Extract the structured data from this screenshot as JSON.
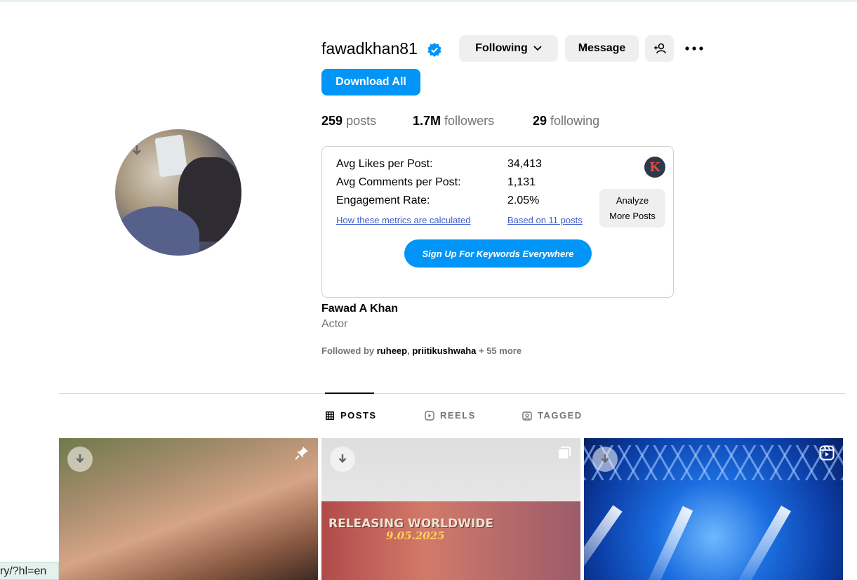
{
  "profile": {
    "username": "fawadkhan81",
    "verified": true,
    "full_name": "Fawad A Khan",
    "category": "Actor"
  },
  "actions": {
    "following_label": "Following",
    "message_label": "Message",
    "download_all_label": "Download All"
  },
  "stats": {
    "posts_count": "259",
    "posts_label": "posts",
    "followers_count": "1.7M",
    "followers_label": "followers",
    "following_count": "29",
    "following_label": "following"
  },
  "metrics": {
    "avg_likes_label": "Avg Likes per Post:",
    "avg_likes_value": "34,413",
    "avg_comments_label": "Avg Comments per Post:",
    "avg_comments_value": "1,131",
    "engagement_label": "Engagement Rate:",
    "engagement_value": "2.05%",
    "how_link": "How these metrics are calculated",
    "based_on_link": "Based on 11 posts",
    "analyze_line1": "Analyze",
    "analyze_line2": "More Posts",
    "signup_label": "Sign Up For Keywords Everywhere",
    "logo_letter": "K"
  },
  "followed_by": {
    "prefix": "Followed by",
    "user1": "ruheep",
    "separator": ",",
    "user2": "priitikushwaha",
    "suffix": "+ 55 more"
  },
  "tabs": [
    {
      "label": "POSTS",
      "icon": "grid-icon",
      "active": true
    },
    {
      "label": "REELS",
      "icon": "reels-icon",
      "active": false
    },
    {
      "label": "TAGGED",
      "icon": "tagged-icon",
      "active": false
    }
  ],
  "posts": [
    {
      "badge_icon": "pin-icon"
    },
    {
      "badge_icon": "carousel-icon",
      "overlay_title": "RELEASING WORLDWIDE",
      "overlay_date": "9.05.2025"
    },
    {
      "badge_icon": "reel-icon"
    }
  ],
  "status_bar": {
    "url_fragment": "ry/?hl=en"
  },
  "colors": {
    "primary_blue": "#0095f6",
    "secondary_button": "#efefef",
    "muted_text": "#737373",
    "link_blue": "#3d5ccc"
  }
}
